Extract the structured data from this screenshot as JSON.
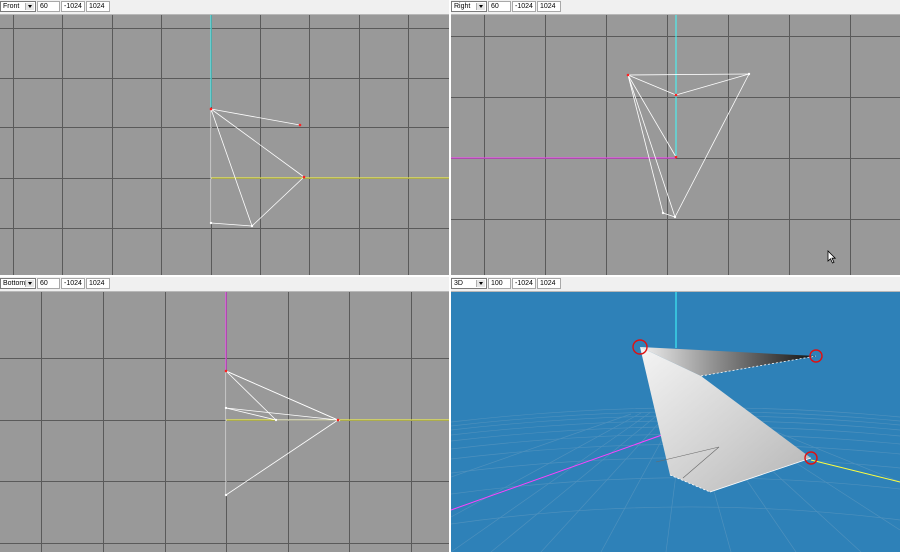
{
  "viewports": [
    {
      "view": "Front",
      "fov": "60",
      "near": "-1024",
      "far": "1024"
    },
    {
      "view": "Right",
      "fov": "60",
      "near": "-1024",
      "far": "1024"
    },
    {
      "view": "Bottom",
      "fov": "60",
      "near": "-1024",
      "far": "1024"
    },
    {
      "view": "3D",
      "fov": "100",
      "near": "-1024",
      "far": "1024"
    }
  ],
  "colors": {
    "ortho_background": "#999999",
    "grid_line": "#5a5a5a",
    "perspective_background": "#2e81b8",
    "axis_x": "#ffff40",
    "axis_y": "#40ffff",
    "axis_z": "#ff40ff",
    "wire": "#ffffff",
    "vertex_selected": "#ff2020",
    "selection_marker": "#e01010"
  },
  "icons": {
    "dropdown": "chevron-down-icon",
    "cursor": "mouse-pointer-icon"
  }
}
